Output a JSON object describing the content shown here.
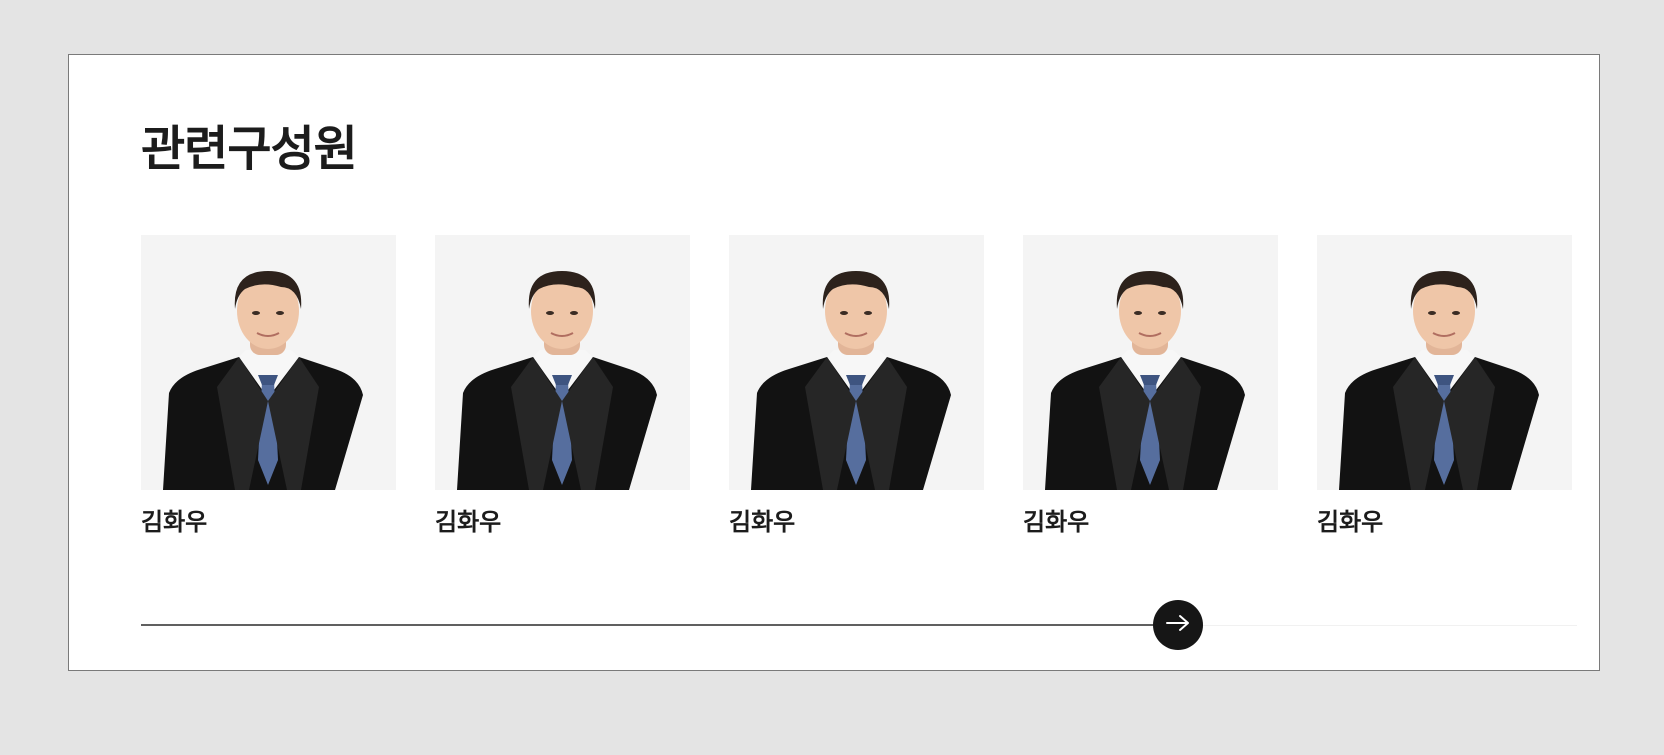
{
  "section": {
    "title": "관련구성원"
  },
  "members": [
    {
      "name": "김화우"
    },
    {
      "name": "김화우"
    },
    {
      "name": "김화우"
    },
    {
      "name": "김화우"
    },
    {
      "name": "김화우"
    }
  ],
  "slider": {
    "progress_fraction": 0.722,
    "button_icon": "arrow-right-icon"
  },
  "colors": {
    "page_background": "#e4e4e4",
    "panel_background": "#ffffff",
    "photo_background": "#f4f4f4",
    "text": "#1c1c1c",
    "slider_button": "#161616",
    "slider_fill": "#606060",
    "slider_track": "#f1f1f1"
  }
}
